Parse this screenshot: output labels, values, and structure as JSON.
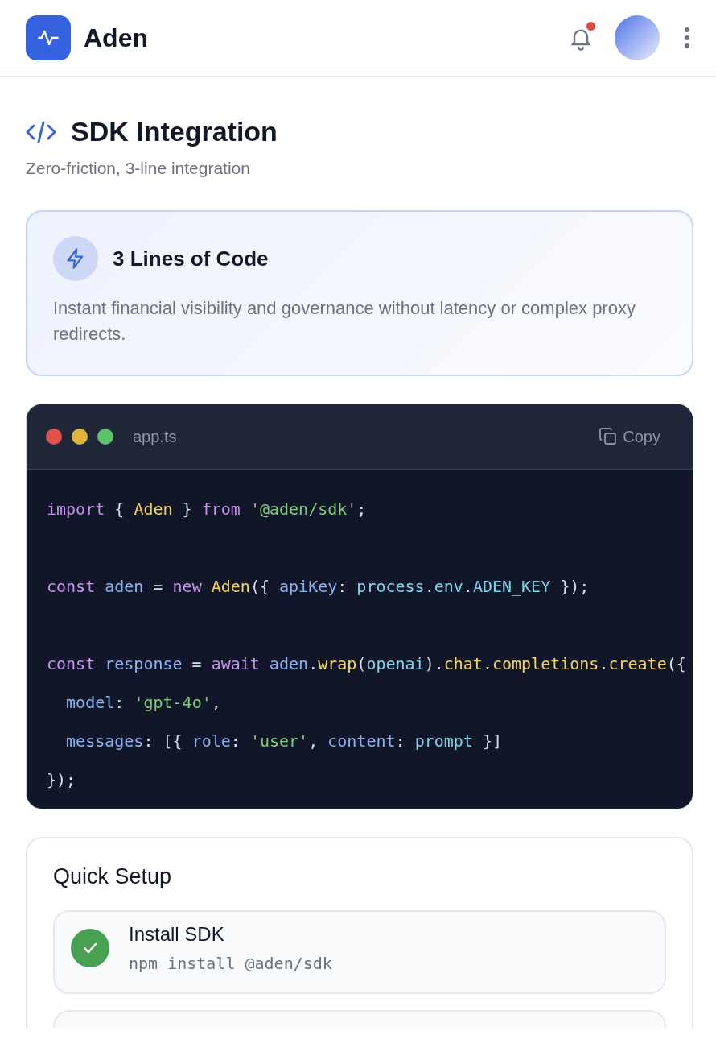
{
  "header": {
    "app_name": "Aden",
    "notifications": {
      "unread": true
    }
  },
  "section": {
    "title": "SDK Integration",
    "subtitle": "Zero-friction, 3-line integration"
  },
  "feature_card": {
    "title": "3 Lines of Code",
    "description": "Instant financial visibility and governance without latency or complex proxy redirects."
  },
  "code_window": {
    "filename": "app.ts",
    "copy_label": "Copy",
    "lines": [
      {
        "kind": "code",
        "tokens": [
          {
            "text": "import",
            "kind": "keyword"
          },
          {
            "text": " { ",
            "kind": "punct"
          },
          {
            "text": "Aden",
            "kind": "class"
          },
          {
            "text": " } ",
            "kind": "punct"
          },
          {
            "text": "from ",
            "kind": "keyword"
          },
          {
            "text": "'@aden/sdk'",
            "kind": "string"
          },
          {
            "text": ";",
            "kind": "punct"
          }
        ]
      },
      {
        "kind": "blank"
      },
      {
        "kind": "code",
        "tokens": [
          {
            "text": "const ",
            "kind": "keyword"
          },
          {
            "text": "aden",
            "kind": "variable"
          },
          {
            "text": " = ",
            "kind": "punct"
          },
          {
            "text": "new ",
            "kind": "keyword"
          },
          {
            "text": "Aden",
            "kind": "class"
          },
          {
            "text": "({ ",
            "kind": "punct"
          },
          {
            "text": "apiKey",
            "kind": "variable"
          },
          {
            "text": ": ",
            "kind": "punct"
          },
          {
            "text": "process",
            "kind": "property"
          },
          {
            "text": ".",
            "kind": "punct"
          },
          {
            "text": "env",
            "kind": "property"
          },
          {
            "text": ".",
            "kind": "punct"
          },
          {
            "text": "ADEN_KEY",
            "kind": "property"
          },
          {
            "text": " });",
            "kind": "punct"
          }
        ]
      },
      {
        "kind": "blank"
      },
      {
        "kind": "code",
        "tokens": [
          {
            "text": "const ",
            "kind": "keyword"
          },
          {
            "text": "response",
            "kind": "variable"
          },
          {
            "text": " = ",
            "kind": "punct"
          },
          {
            "text": "await ",
            "kind": "keyword"
          },
          {
            "text": "aden",
            "kind": "variable"
          },
          {
            "text": ".",
            "kind": "punct"
          },
          {
            "text": "wrap",
            "kind": "method"
          },
          {
            "text": "(",
            "kind": "punct"
          },
          {
            "text": "openai",
            "kind": "property"
          },
          {
            "text": ").",
            "kind": "punct"
          },
          {
            "text": "chat",
            "kind": "method"
          },
          {
            "text": ".",
            "kind": "punct"
          },
          {
            "text": "completions",
            "kind": "method"
          },
          {
            "text": ".",
            "kind": "punct"
          },
          {
            "text": "create",
            "kind": "method"
          },
          {
            "text": "({",
            "kind": "punct"
          }
        ]
      },
      {
        "kind": "code",
        "tokens": [
          {
            "text": "  model",
            "kind": "variable"
          },
          {
            "text": ": ",
            "kind": "punct"
          },
          {
            "text": "'gpt-4o'",
            "kind": "string"
          },
          {
            "text": ",",
            "kind": "punct"
          }
        ]
      },
      {
        "kind": "code",
        "tokens": [
          {
            "text": "  messages",
            "kind": "variable"
          },
          {
            "text": ": [{ ",
            "kind": "punct"
          },
          {
            "text": "role",
            "kind": "variable"
          },
          {
            "text": ": ",
            "kind": "punct"
          },
          {
            "text": "'user'",
            "kind": "string"
          },
          {
            "text": ", ",
            "kind": "punct"
          },
          {
            "text": "content",
            "kind": "variable"
          },
          {
            "text": ": ",
            "kind": "punct"
          },
          {
            "text": "prompt",
            "kind": "property"
          },
          {
            "text": " }]",
            "kind": "punct"
          }
        ]
      },
      {
        "kind": "code",
        "tokens": [
          {
            "text": "});",
            "kind": "punct"
          }
        ]
      }
    ]
  },
  "quick_setup": {
    "title": "Quick Setup",
    "steps": [
      {
        "title": "Install SDK",
        "command": "npm install @aden/sdk",
        "done": true
      }
    ]
  }
}
